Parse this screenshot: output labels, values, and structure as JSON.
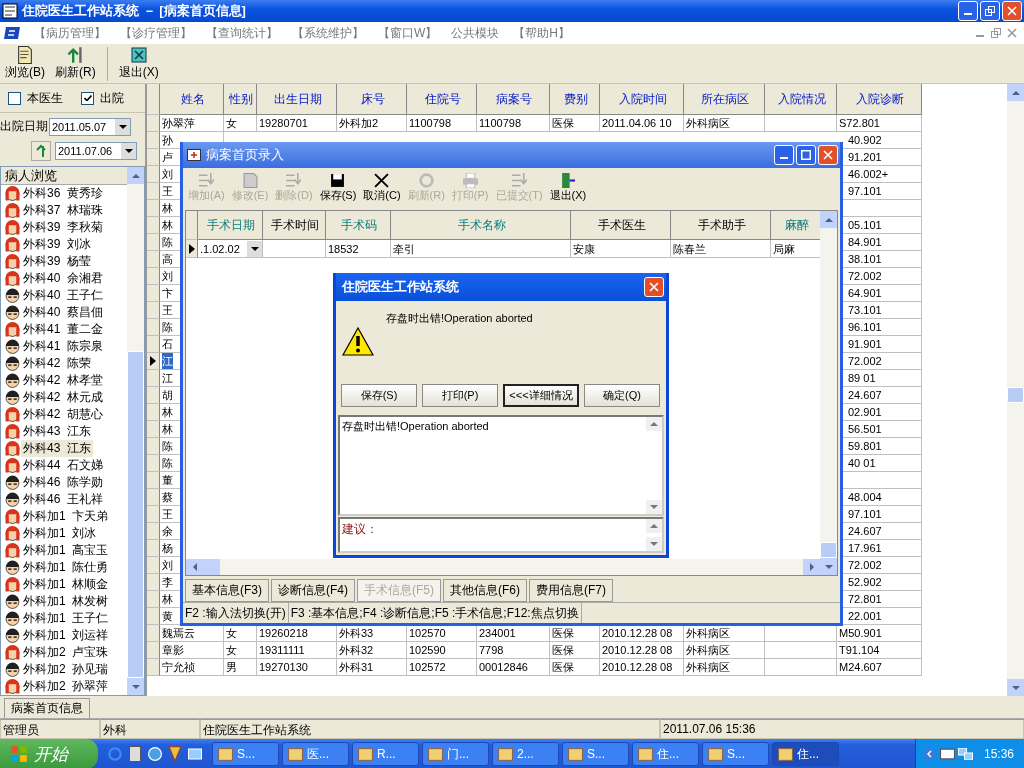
{
  "window": {
    "title": "住院医生工作站系统 － [病案首页信息]"
  },
  "menu": [
    {
      "label": "【病历管理】"
    },
    {
      "label": "【诊疗管理】"
    },
    {
      "label": "【查询统计】"
    },
    {
      "label": "【系统维护】"
    },
    {
      "label": "【窗口W】"
    },
    {
      "label": "公共模块"
    },
    {
      "label": "【帮助H】"
    }
  ],
  "toolbar": [
    {
      "label": "浏览(B)",
      "kind": "browse"
    },
    {
      "label": "刷新(R)",
      "kind": "refresh"
    },
    {
      "label": "退出(X)",
      "kind": "exit"
    }
  ],
  "filters": {
    "checkboxes": [
      {
        "label": "本医生",
        "checked": false
      },
      {
        "label": "出院",
        "checked": true
      }
    ],
    "date_label": "出院日期",
    "date_from": "2011.05.07",
    "date_to": "2011.07.06"
  },
  "patient_list": {
    "title": "病人浏览",
    "items": [
      {
        "bed": "外科36",
        "name": "黄秀珍",
        "kind": "female",
        "selected": false
      },
      {
        "bed": "外科37",
        "name": "林瑞珠",
        "kind": "female",
        "selected": false
      },
      {
        "bed": "外科39",
        "name": "李秋菊",
        "kind": "female",
        "selected": false
      },
      {
        "bed": "外科39",
        "name": "刘冰",
        "kind": "female",
        "selected": false
      },
      {
        "bed": "外科39",
        "name": "杨莹",
        "kind": "female",
        "selected": false
      },
      {
        "bed": "外科40",
        "name": "余湘君",
        "kind": "female",
        "selected": false
      },
      {
        "bed": "外科40",
        "name": "王子仁",
        "kind": "male",
        "selected": false
      },
      {
        "bed": "外科40",
        "name": "蔡昌佃",
        "kind": "male",
        "selected": false
      },
      {
        "bed": "外科41",
        "name": "董二金",
        "kind": "female",
        "selected": false
      },
      {
        "bed": "外科41",
        "name": "陈宗泉",
        "kind": "male",
        "selected": false
      },
      {
        "bed": "外科42",
        "name": "陈荣",
        "kind": "male",
        "selected": false
      },
      {
        "bed": "外科42",
        "name": "林孝堂",
        "kind": "male",
        "selected": false
      },
      {
        "bed": "外科42",
        "name": "林元成",
        "kind": "male",
        "selected": false
      },
      {
        "bed": "外科42",
        "name": "胡慧心",
        "kind": "female",
        "selected": false
      },
      {
        "bed": "外科43",
        "name": "江东",
        "kind": "female",
        "selected": false
      },
      {
        "bed": "外科43",
        "name": "江东",
        "kind": "female",
        "selected": true
      },
      {
        "bed": "外科44",
        "name": "石文娣",
        "kind": "female",
        "selected": false
      },
      {
        "bed": "外科46",
        "name": "陈学勋",
        "kind": "male",
        "selected": false
      },
      {
        "bed": "外科46",
        "name": "王礼祥",
        "kind": "male",
        "selected": false
      },
      {
        "bed": "外科加1",
        "name": "卞天弟",
        "kind": "female",
        "selected": false
      },
      {
        "bed": "外科加1",
        "name": "刘冰",
        "kind": "female",
        "selected": false
      },
      {
        "bed": "外科加1",
        "name": "高宝玉",
        "kind": "female",
        "selected": false
      },
      {
        "bed": "外科加1",
        "name": "陈仕勇",
        "kind": "male",
        "selected": false
      },
      {
        "bed": "外科加1",
        "name": "林顺金",
        "kind": "female",
        "selected": false
      },
      {
        "bed": "外科加1",
        "name": "林发树",
        "kind": "male",
        "selected": false
      },
      {
        "bed": "外科加1",
        "name": "王子仁",
        "kind": "male",
        "selected": false
      },
      {
        "bed": "外科加1",
        "name": "刘运祥",
        "kind": "male",
        "selected": false
      },
      {
        "bed": "外科加2",
        "name": "卢宝珠",
        "kind": "female",
        "selected": false
      },
      {
        "bed": "外科加2",
        "name": "孙见瑞",
        "kind": "male",
        "selected": false
      },
      {
        "bed": "外科加2",
        "name": "孙翠萍",
        "kind": "female",
        "selected": false
      }
    ]
  },
  "table": {
    "columns": [
      "姓名",
      "性别",
      "出生日期",
      "床号",
      "住院号",
      "病案号",
      "费别",
      "入院时间",
      "所在病区",
      "入院情况",
      "入院诊断"
    ],
    "rows": [
      {
        "kind": "full",
        "selected": false,
        "cells": [
          "孙翠萍",
          "女",
          "19280701",
          "外科加2",
          "1100798",
          "1100798",
          "医保",
          "2011.04.06 10",
          "外科病区",
          "",
          "S72.801"
        ]
      },
      {
        "kind": "partial",
        "selected": false,
        "name": "孙",
        "diagnosis": "40.902"
      },
      {
        "kind": "partial",
        "selected": false,
        "name": "卢",
        "diagnosis": "91.201"
      },
      {
        "kind": "partial",
        "selected": false,
        "name": "刘",
        "diagnosis": "46.002+"
      },
      {
        "kind": "partial",
        "selected": false,
        "name": "王",
        "diagnosis": "97.101"
      },
      {
        "kind": "partial",
        "selected": false,
        "name": "林",
        "diagnosis": ""
      },
      {
        "kind": "partial",
        "selected": false,
        "name": "林",
        "diagnosis": "05.101"
      },
      {
        "kind": "partial",
        "selected": false,
        "name": "陈",
        "diagnosis": "84.901"
      },
      {
        "kind": "partial",
        "selected": false,
        "name": "高",
        "diagnosis": "38.101"
      },
      {
        "kind": "partial",
        "selected": false,
        "name": "刘",
        "diagnosis": "72.002"
      },
      {
        "kind": "partial",
        "selected": false,
        "name": "卞",
        "diagnosis": "64.901"
      },
      {
        "kind": "partial",
        "selected": false,
        "name": "王",
        "diagnosis": "73.101"
      },
      {
        "kind": "partial",
        "selected": false,
        "name": "陈",
        "diagnosis": "96.101"
      },
      {
        "kind": "partial",
        "selected": false,
        "name": "石",
        "diagnosis": "91.901"
      },
      {
        "kind": "partial",
        "selected": true,
        "name": "江",
        "diagnosis": "72.002"
      },
      {
        "kind": "partial",
        "selected": false,
        "name": "江",
        "diagnosis": "89 01"
      },
      {
        "kind": "partial",
        "selected": false,
        "name": "胡",
        "diagnosis": "24.607"
      },
      {
        "kind": "partial",
        "selected": false,
        "name": "林",
        "diagnosis": "02.901"
      },
      {
        "kind": "partial",
        "selected": false,
        "name": "林",
        "diagnosis": "56.501"
      },
      {
        "kind": "partial",
        "selected": false,
        "name": "陈",
        "diagnosis": "59.801"
      },
      {
        "kind": "partial",
        "selected": false,
        "name": "陈",
        "diagnosis": "40 01"
      },
      {
        "kind": "partial",
        "selected": false,
        "name": "董",
        "diagnosis": ""
      },
      {
        "kind": "partial",
        "selected": false,
        "name": "蔡",
        "diagnosis": "48.004"
      },
      {
        "kind": "partial",
        "selected": false,
        "name": "王",
        "diagnosis": "97.101"
      },
      {
        "kind": "partial",
        "selected": false,
        "name": "余",
        "diagnosis": "24.607"
      },
      {
        "kind": "partial",
        "selected": false,
        "name": "杨",
        "diagnosis": "17.961"
      },
      {
        "kind": "partial",
        "selected": false,
        "name": "刘",
        "diagnosis": "72.002"
      },
      {
        "kind": "partial",
        "selected": false,
        "name": "李",
        "diagnosis": "52.902"
      },
      {
        "kind": "partial",
        "selected": false,
        "name": "林",
        "diagnosis": "72.801"
      },
      {
        "kind": "partial",
        "selected": false,
        "name": "黄",
        "diagnosis": "22.001"
      },
      {
        "kind": "full",
        "selected": false,
        "cells": [
          "魏焉云",
          "女",
          "19260218",
          "外科33",
          "102570",
          "234001",
          "医保",
          "2010.12.28 08",
          "外科病区",
          "",
          "M50.901"
        ]
      },
      {
        "kind": "full",
        "selected": false,
        "cells": [
          "章影",
          "女",
          "19311111",
          "外科32",
          "102590",
          "7798",
          "医保",
          "2010.12.28 08",
          "外科病区",
          "",
          "T91.104"
        ]
      },
      {
        "kind": "full",
        "selected": false,
        "cells": [
          "宁允祯",
          "男",
          "19270130",
          "外科31",
          "102572",
          "00012846",
          "医保",
          "2010.12.28 08",
          "外科病区",
          "",
          "M24.607"
        ]
      }
    ]
  },
  "record_dialog": {
    "title": "病案首页录入",
    "toolbar": [
      {
        "label": "增加(A)",
        "kind": "add",
        "disabled": true
      },
      {
        "label": "修改(E)",
        "kind": "edit",
        "disabled": true
      },
      {
        "label": "删除(D)",
        "kind": "delete",
        "disabled": true
      },
      {
        "label": "保存(S)",
        "kind": "save",
        "disabled": false
      },
      {
        "label": "取消(C)",
        "kind": "cancel",
        "disabled": false
      },
      {
        "label": "刷新(R)",
        "kind": "refresh",
        "disabled": true
      },
      {
        "label": "打印(P)",
        "kind": "print",
        "disabled": true
      },
      {
        "label": "已提交(T)",
        "kind": "submit",
        "disabled": true
      },
      {
        "label": "退出(X)",
        "kind": "exit",
        "disabled": false
      }
    ],
    "columns": [
      {
        "label": "手术日期",
        "highlighted": true
      },
      {
        "label": "手术时间",
        "highlighted": false
      },
      {
        "label": "手术码",
        "highlighted": true
      },
      {
        "label": "手术名称",
        "highlighted": true
      },
      {
        "label": "手术医生",
        "highlighted": false
      },
      {
        "label": "手术助手",
        "highlighted": false
      },
      {
        "label": "麻醉",
        "highlighted": true
      }
    ],
    "rows": [
      {
        "cells": [
          ".1.02.02",
          "",
          "18532",
          "牵引",
          "安康",
          "陈春兰",
          "局麻"
        ]
      }
    ],
    "tabs": [
      {
        "label": "基本信息(F3)",
        "selected": false
      },
      {
        "label": "诊断信息(F4)",
        "selected": false
      },
      {
        "label": "手术信息(F5)",
        "selected": true
      },
      {
        "label": "其他信息(F6)",
        "selected": false
      },
      {
        "label": "费用信息(F7)",
        "selected": false
      }
    ],
    "status": [
      "F2 :输入法切换(开)",
      "F3 :基本信息;F4 :诊断信息;F5 :手术信息;F12:焦点切换"
    ]
  },
  "message_box": {
    "title": "住院医生工作站系统",
    "message": "存盘时出错!Operation aborted",
    "buttons": [
      {
        "label": "保存(S)",
        "focused": false
      },
      {
        "label": "打印(P)",
        "focused": false
      },
      {
        "label": "<<<详细情况",
        "focused": true
      },
      {
        "label": "确定(Q)",
        "focused": false
      }
    ],
    "details": "存盘时出错!Operation aborted",
    "suggestion_label": "建议："
  },
  "bottom_tab": "病案首页信息",
  "status_bar": [
    "管理员",
    "外科",
    "住院医生工作站系统",
    "2011.07.06 15:36"
  ],
  "taskbar": {
    "start": "开始",
    "tasks": [
      {
        "label": "S...",
        "selected": false
      },
      {
        "label": "医...",
        "selected": false
      },
      {
        "label": "R...",
        "selected": false
      },
      {
        "label": "门...",
        "selected": false
      },
      {
        "label": "2...",
        "selected": false
      },
      {
        "label": "S...",
        "selected": false
      },
      {
        "label": "住...",
        "selected": false
      },
      {
        "label": "S...",
        "selected": false
      },
      {
        "label": "住...",
        "selected": true
      }
    ],
    "clock": "15:36"
  }
}
